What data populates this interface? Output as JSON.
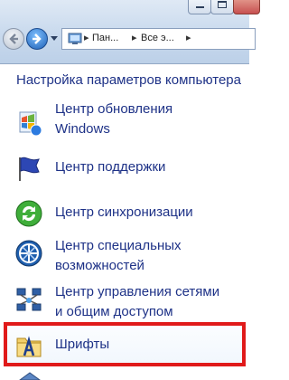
{
  "address_bar": {
    "crumbs": [
      "Пан...",
      "Все э..."
    ]
  },
  "panel": {
    "heading": "Настройка параметров компьютера"
  },
  "items": [
    {
      "lines": [
        "Центр обновления",
        "Windows"
      ],
      "icon": "windows-update-icon"
    },
    {
      "lines": [
        "Центр поддержки"
      ],
      "icon": "action-center-flag-icon"
    },
    {
      "lines": [
        "Центр синхронизации"
      ],
      "icon": "sync-center-icon"
    },
    {
      "lines": [
        "Центр специальных",
        "возможностей"
      ],
      "icon": "ease-of-access-icon"
    },
    {
      "lines": [
        "Центр управления сетями",
        "и общим доступом"
      ],
      "icon": "network-center-icon"
    },
    {
      "lines": [
        "Шрифты"
      ],
      "icon": "fonts-folder-icon"
    }
  ],
  "colors": {
    "link": "#1e3287",
    "highlight_border": "#e01a1a"
  }
}
